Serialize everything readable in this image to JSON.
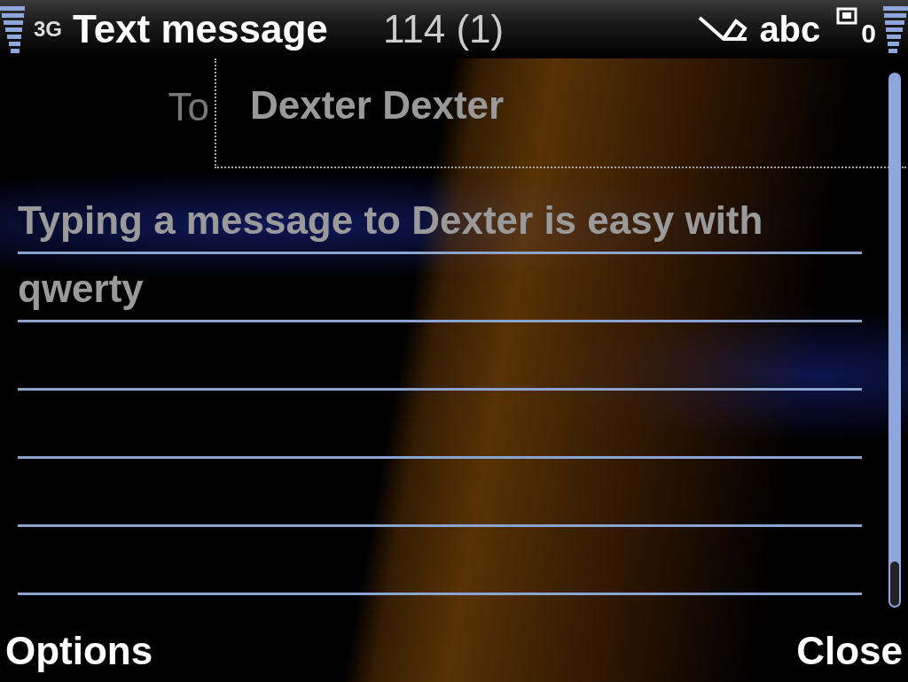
{
  "status_bar": {
    "network": "3G",
    "title": "Text message",
    "counter": "114 (1)",
    "input_mode": "abc",
    "queue_count": "0"
  },
  "to_field": {
    "label": "To",
    "value": "Dexter Dexter"
  },
  "message": {
    "value": "Typing a message to Dexter is easy with qwerty"
  },
  "softkeys": {
    "left": "Options",
    "right": "Close"
  }
}
